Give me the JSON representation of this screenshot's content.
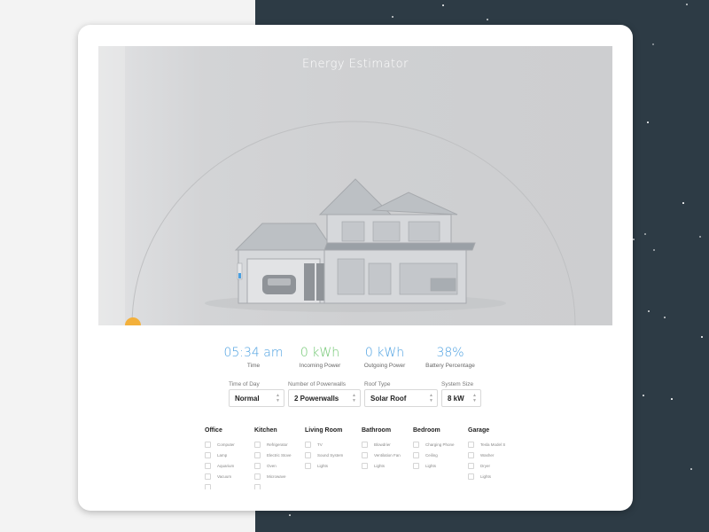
{
  "title": "Energy Estimator",
  "stats": [
    {
      "value": "05:34 am",
      "label": "Time",
      "color": "#4a9fe0"
    },
    {
      "value": "0 kWh",
      "label": "Incoming Power",
      "color": "#6cc56d"
    },
    {
      "value": "0 kWh",
      "label": "Outgoing Power",
      "color": "#4a9fe0"
    },
    {
      "value": "38%",
      "label": "Battery Percentage",
      "color": "#4a9fe0"
    }
  ],
  "controls": [
    {
      "label": "Time of Day",
      "value": "Normal"
    },
    {
      "label": "Number of Powerwalls",
      "value": "2 Powerwalls"
    },
    {
      "label": "Roof Type",
      "value": "Solar Roof"
    },
    {
      "label": "System Size",
      "value": "8 kW"
    }
  ],
  "categories": [
    {
      "name": "Office",
      "items": [
        "Computer",
        "Lamp",
        "Aquarium",
        "Vacuum",
        ""
      ]
    },
    {
      "name": "Kitchen",
      "items": [
        "Refrigerator",
        "Electric Stove",
        "Oven",
        "Microwave",
        ""
      ]
    },
    {
      "name": "Living Room",
      "items": [
        "TV",
        "Sound System",
        "Lights"
      ]
    },
    {
      "name": "Bathroom",
      "items": [
        "Blowdrier",
        "Ventilation Fan",
        "Lights"
      ]
    },
    {
      "name": "Bedroom",
      "items": [
        "Charging Phone",
        "Ceiling",
        "Lights"
      ]
    },
    {
      "name": "Garage",
      "items": [
        "Tesla Model S",
        "Washer",
        "Dryer",
        "Lights"
      ]
    }
  ],
  "battery_level": 0.38,
  "colors": {
    "accent_blue": "#4a9fe0",
    "accent_green": "#6cc56d",
    "sun": "#f3b03b",
    "night_bg": "#2d3b45"
  }
}
